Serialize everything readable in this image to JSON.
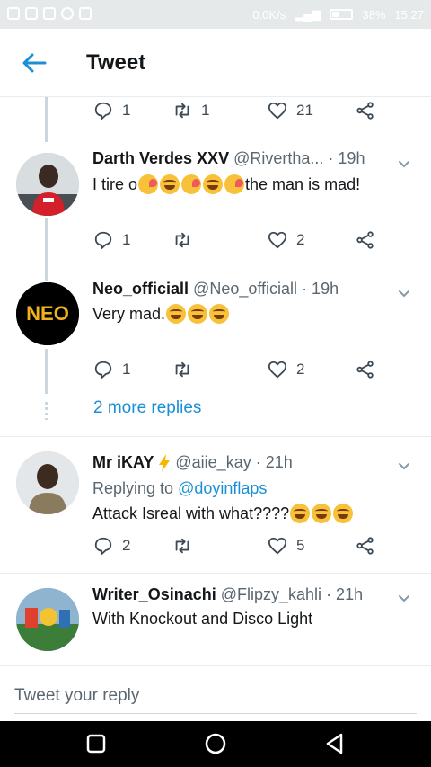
{
  "status_bar": {
    "speed": "0.0K/s",
    "battery": "38%",
    "time": "15:27"
  },
  "header": {
    "title": "Tweet"
  },
  "top_actions": {
    "replies": "1",
    "retweets": "1",
    "likes": "21"
  },
  "replies": [
    {
      "name": "Darth Verdes XXV",
      "handle": "@Rivertha...",
      "time": "· 19h",
      "text_start": "I tire o",
      "text_end": " the man is mad!",
      "actions": {
        "replies": "1",
        "retweets": "",
        "likes": "2"
      }
    },
    {
      "name": "Neo_officiall",
      "handle": "@Neo_officiall",
      "time": "· 19h",
      "text_start": "Very mad.",
      "avatar_text": "NEO",
      "actions": {
        "replies": "1",
        "retweets": "",
        "likes": "2"
      }
    },
    {
      "name": "Mr iKAY",
      "handle": "@aiie_kay",
      "time": "· 21h",
      "replying_label": "Replying to",
      "replying_handle": "@doyinflaps",
      "text_start": "Attack Isreal with what???? ",
      "actions": {
        "replies": "2",
        "retweets": "",
        "likes": "5"
      }
    },
    {
      "name": "Writer_Osinachi",
      "handle": "@Flipzy_kahli",
      "time": "· 21h",
      "text_start": "With Knockout and Disco Light"
    }
  ],
  "more_replies": "2 more replies",
  "reply_box": {
    "placeholder": "Tweet your reply"
  },
  "colors": {
    "accent": "#1b8fd6",
    "text": "#14171a",
    "muted": "#5b6770",
    "line": "#ccd6dd"
  }
}
